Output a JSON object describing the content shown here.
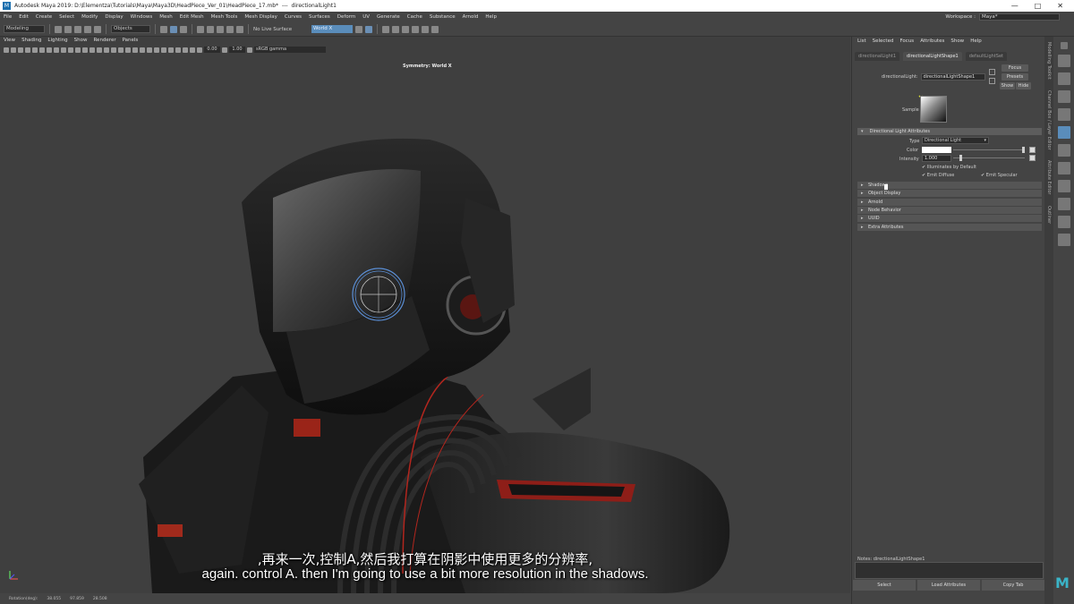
{
  "titlebar": {
    "app": "Autodesk Maya 2019: D:\\Elementza\\Tutorials\\Maya\\Maya3D\\HeadPiece_Ver_01\\HeadPiece_17.mb*",
    "sep": "---",
    "node": "directionalLight1",
    "logo": "M"
  },
  "menubar": {
    "items": [
      "File",
      "Edit",
      "Create",
      "Select",
      "Modify",
      "Display",
      "Windows",
      "Mesh",
      "Edit Mesh",
      "Mesh Tools",
      "Mesh Display",
      "Curves",
      "Surfaces",
      "Deform",
      "UV",
      "Generate",
      "Cache",
      "Substance",
      "Arnold",
      "Help"
    ],
    "workspace_label": "Workspace :",
    "workspace_value": "Maya*"
  },
  "statusline": {
    "mode": "Modeling",
    "select_mode": "Objects",
    "live_surface": "No Live Surface",
    "world_field": "World X"
  },
  "viewport": {
    "menu": [
      "View",
      "Shading",
      "Lighting",
      "Show",
      "Renderer",
      "Panels"
    ],
    "near_value": "0.00",
    "far_value": "1.00",
    "color_space": "sRGB gamma",
    "symmetry": "Symmetry: World X"
  },
  "subtitles": {
    "chinese": ",再来一次,控制A,然后我打算在阴影中使用更多的分辨率,",
    "english": "again. control A. then I'm going to use a bit more resolution in the shadows."
  },
  "helpline": {
    "label": "Rotation(deg):",
    "x": "38.055",
    "y": "97.859",
    "z": "28.508"
  },
  "attribute_editor": {
    "menu": [
      "List",
      "Selected",
      "Focus",
      "Attributes",
      "Show",
      "Help"
    ],
    "tabs": [
      "directionalLight1",
      "directionalLightShape1",
      "defaultLightSet"
    ],
    "active_tab": 1,
    "name_label": "directionalLight:",
    "name_value": "directionalLightShape1",
    "buttons": {
      "focus": "Focus",
      "presets": "Presets",
      "show": "Show",
      "hide": "Hide"
    },
    "sample_label": "Sample",
    "section_main": "Directional Light Attributes",
    "type_label": "Type",
    "type_value": "Directional Light",
    "color_label": "Color",
    "intensity_label": "Intensity",
    "intensity_value": "1.000",
    "intensity_level": 0.2,
    "illuminates_label": "Illuminates by Default",
    "emit_diffuse_label": "Emit Diffuse",
    "emit_specular_label": "Emit Specular",
    "sections": [
      "Shadows",
      "Object Display",
      "Arnold",
      "Node Behavior",
      "UUID",
      "Extra Attributes"
    ],
    "notes_label": "Notes: directionalLightShape1",
    "bottom_buttons": [
      "Select",
      "Load Attributes",
      "Copy Tab"
    ]
  },
  "side_tabs": [
    "Modelling Toolkit",
    "Channel Box / Layer Editor",
    "Attribute Editor",
    "Outliner"
  ],
  "accent_color": "#5a8dbb",
  "rim_red": "#b3261e"
}
